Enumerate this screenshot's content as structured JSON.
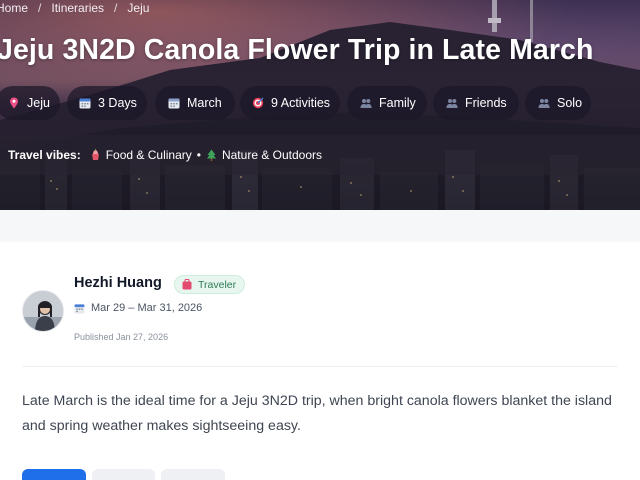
{
  "breadcrumb": {
    "items": [
      "Home",
      "Itineraries",
      "Jeju"
    ],
    "separator": "/"
  },
  "title": "Jeju 3N2D Canola Flower Trip in Late March",
  "chips": [
    {
      "label": "Jeju",
      "icon": "location-pin-icon"
    },
    {
      "label": "3 Days",
      "icon": "calendar-icon"
    },
    {
      "label": "March",
      "icon": "calendar-icon"
    },
    {
      "label": "9 Activities",
      "icon": "target-icon"
    },
    {
      "label": "Family",
      "icon": "people-icon"
    },
    {
      "label": "Friends",
      "icon": "people-icon"
    },
    {
      "label": "Solo",
      "icon": "people-icon"
    }
  ],
  "vibes": {
    "label": "Travel vibes:",
    "separator": "•",
    "items": [
      {
        "label": "Food & Culinary",
        "icon": "food-icon"
      },
      {
        "label": "Nature & Outdoors",
        "icon": "tree-icon"
      }
    ]
  },
  "author": {
    "name": "Hezhi Huang",
    "badge": "Traveler",
    "dates": "Mar 29 – Mar 31, 2026",
    "published": "Published Jan 27, 2026"
  },
  "description": "Late March is the ideal time for a Jeju 3N2D trip, when bright canola flowers blanket the island and spring weather makes sightseeing easy.",
  "colors": {
    "accent": "#1f6feb",
    "badge_bg": "#e7f6ee",
    "badge_text": "#2f7a55",
    "chip_bg": "#1c1828"
  }
}
